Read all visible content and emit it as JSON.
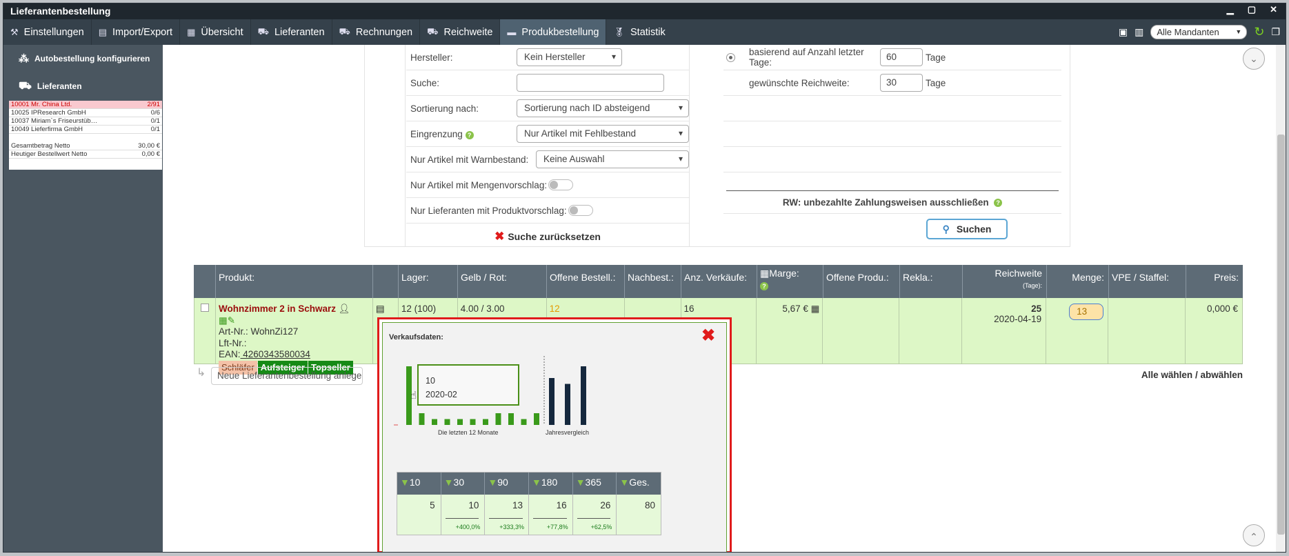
{
  "window": {
    "title": "Lieferantenbestellung"
  },
  "menu": {
    "items": [
      {
        "label": "Einstellungen",
        "icon": "wrench-icon"
      },
      {
        "label": "Import/Export",
        "icon": "document-icon"
      },
      {
        "label": "Übersicht",
        "icon": "grid-icon"
      },
      {
        "label": "Lieferanten",
        "icon": "truck-icon"
      },
      {
        "label": "Rechnungen",
        "icon": "truck-icon"
      },
      {
        "label": "Reichweite",
        "icon": "truck-icon"
      },
      {
        "label": "Produkbestellung",
        "icon": "barcode-icon"
      },
      {
        "label": "Statistik",
        "icon": "medal-icon"
      }
    ],
    "active_index": 6,
    "mandant_select": "Alle Mandanten"
  },
  "sidebar": {
    "link1": "Autobestellung konfigurieren",
    "link2": "Lieferanten",
    "suppliers": [
      {
        "name": "10001 Mr. China Ltd.",
        "count": "2/91"
      },
      {
        "name": "10025 IPResearch GmbH",
        "count": "0/6"
      },
      {
        "name": "10037 Miriam`s Friseurstüb…",
        "count": "0/1"
      },
      {
        "name": "10049 Lieferfirma GmbH",
        "count": "0/1"
      }
    ],
    "total_label": "Gesamtbetrag Netto",
    "total_value": "30,00 €",
    "today_label": "Heutiger Bestellwert Netto",
    "today_value": "0,00 €"
  },
  "filter": {
    "hersteller_label": "Hersteller:",
    "hersteller_value": "Kein Hersteller",
    "suche_label": "Suche:",
    "suche_value": "",
    "sort_label": "Sortierung nach:",
    "sort_value": "Sortierung nach ID absteigend",
    "eingrenzung_label": "Eingrenzung",
    "eingrenzung_value": "Nur Artikel mit Fehlbestand",
    "warn_label": "Nur Artikel mit Warnbestand:",
    "warn_value": "Keine Auswahl",
    "mengen_label": "Nur Artikel mit Mengenvorschlag:",
    "lief_label": "Nur Lieferanten mit Produktvorschlag:",
    "reset_label": "Suche zurücksetzen",
    "basis_label": "basierend auf Anzahl letzter Tage:",
    "basis_value": "60",
    "basis_unit": "Tage",
    "reichweite_label": "gewünschte Reichweite:",
    "reichweite_value": "30",
    "reichweite_unit": "Tage",
    "rw_label": "RW: unbezahlte Zahlungsweisen ausschließen",
    "search_button": "Suchen"
  },
  "table": {
    "headers": {
      "produkt": "Produkt:",
      "lager": "Lager:",
      "gelbrot": "Gelb / Rot:",
      "offene": "Offene Bestell.:",
      "nachbest": "Nachbest.:",
      "verkaeufe": "Anz. Verkäufe:",
      "marge": "Marge:",
      "offene_prod": "Offene Produ.:",
      "rekla": "Rekla.:",
      "reichweite": "Reichweite",
      "reichweite_sub": "(Tage):",
      "menge": "Menge:",
      "vpe": "VPE / Staffel:",
      "preis": "Preis:"
    },
    "row": {
      "name": "Wohnzimmer 2 in Schwarz",
      "artnr": "Art-Nr.: WohnZi127",
      "lftnr": "Lft-Nr.:",
      "ean_label": "EAN:",
      "ean": " 4260343580034",
      "tags": [
        "Schläfer",
        "Aufsteiger",
        "Topseller"
      ],
      "lager": "12 (100)",
      "gelbrot": "4.00 / 3.00",
      "offene": "12",
      "verkaeufe": "16",
      "marge": "5,67 €",
      "reichweite_days": "25",
      "reichweite_date": "2020-04-19",
      "menge": "13",
      "preis": "0,000 €"
    },
    "new_order_placeholder": "Neue Lieferantenbestellung anlege",
    "select_all": "Alle wählen",
    "deselect_all": "abwählen",
    "select_sep": "/"
  },
  "popup": {
    "title": "Verkaufsdaten:",
    "tooltip_value": "10",
    "tooltip_date": "2020-02",
    "caption_months": "Die letzten 12 Monate",
    "caption_year": "Jahresvergleich",
    "stats_headers": [
      "10",
      "30",
      "90",
      "180",
      "365",
      "Ges."
    ],
    "stats_values": [
      "5",
      "10",
      "13",
      "16",
      "26",
      "80"
    ],
    "stats_pcts": [
      "",
      "+400,0%",
      "+333,3%",
      "+77,8%",
      "+62,5%",
      ""
    ]
  },
  "chart_data": {
    "type": "bar",
    "monthly_values": [
      10,
      2,
      1,
      1,
      1,
      1,
      1,
      2,
      2,
      1,
      2
    ],
    "yearly_values": [
      8,
      7,
      10
    ],
    "highlight": {
      "value": 10,
      "date": "2020-02"
    },
    "colors": {
      "monthly": "#3a9a1b",
      "yearly": "#15283d"
    }
  }
}
